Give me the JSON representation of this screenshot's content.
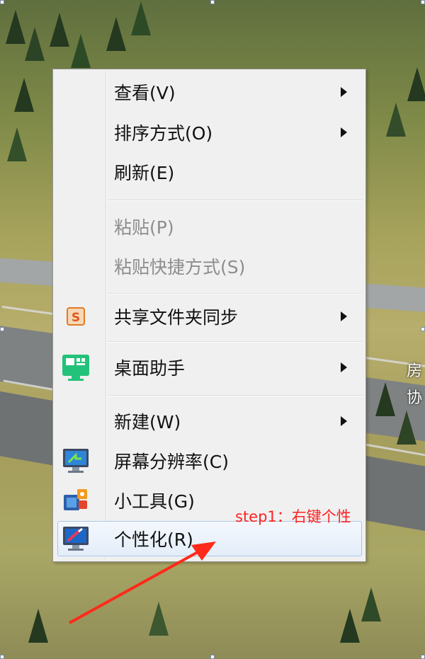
{
  "context_menu": {
    "items": [
      {
        "label": "查看(V)",
        "submenu": true,
        "enabled": true
      },
      {
        "label": "排序方式(O)",
        "submenu": true,
        "enabled": true
      },
      {
        "label": "刷新(E)",
        "submenu": false,
        "enabled": true
      },
      {
        "label": "粘贴(P)",
        "submenu": false,
        "enabled": false
      },
      {
        "label": "粘贴快捷方式(S)",
        "submenu": false,
        "enabled": false
      },
      {
        "label": "共享文件夹同步",
        "submenu": true,
        "enabled": true,
        "icon": "wps-sync-icon"
      },
      {
        "label": "桌面助手",
        "submenu": true,
        "enabled": true,
        "icon": "desktop-assistant-icon"
      },
      {
        "label": "新建(W)",
        "submenu": true,
        "enabled": true
      },
      {
        "label": "屏幕分辨率(C)",
        "submenu": false,
        "enabled": true,
        "icon": "screen-resolution-icon"
      },
      {
        "label": "小工具(G)",
        "submenu": false,
        "enabled": true,
        "icon": "gadgets-icon"
      },
      {
        "label": "个性化(R)",
        "submenu": false,
        "enabled": true,
        "icon": "personalize-icon",
        "hovered": true
      }
    ]
  },
  "annotation": {
    "text": "step1：右键个性",
    "color": "#ff2222"
  },
  "desktop": {
    "edge_text": [
      "房",
      "协"
    ]
  },
  "colors": {
    "menu_bg": "#f0f0f0",
    "hover_border": "#a8c6e8",
    "disabled_text": "#8d8d8d",
    "arrow": "#ff2a1a"
  }
}
